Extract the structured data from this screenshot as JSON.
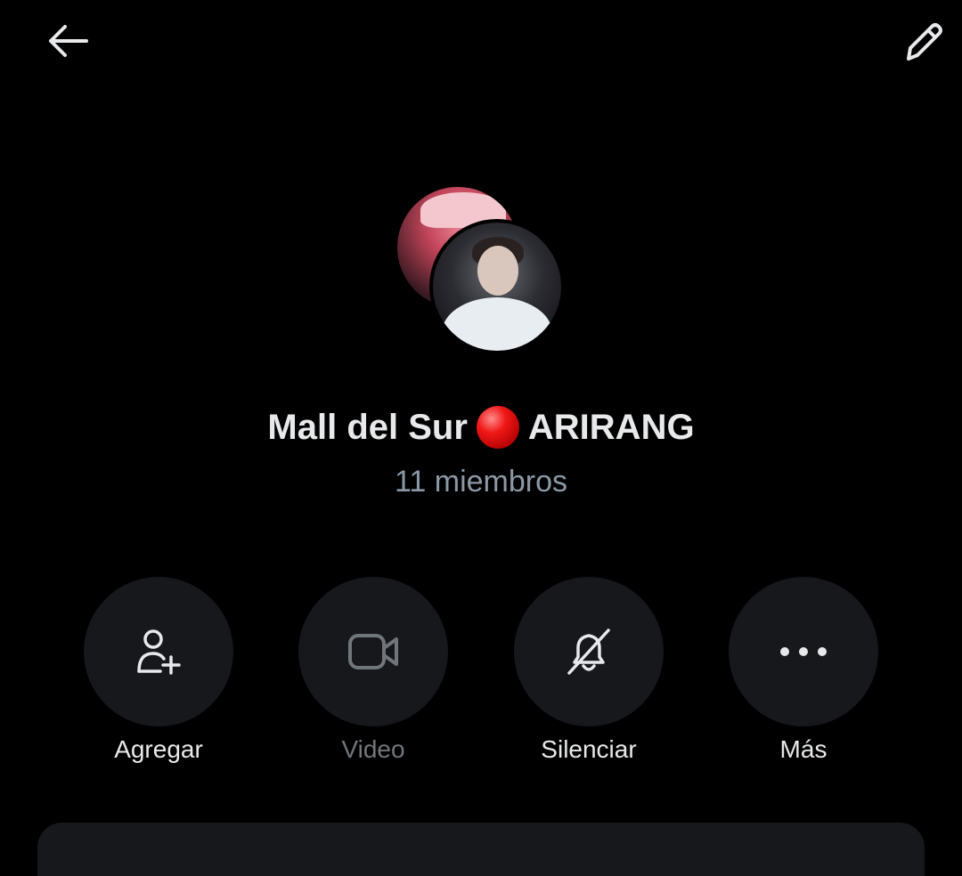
{
  "header": {
    "back_icon": "arrow-left-icon",
    "edit_icon": "pencil-icon"
  },
  "group": {
    "name_part1": "Mall del Sur",
    "name_emoji": "red-circle",
    "name_part2": "ARIRANG",
    "members": "11 miembros"
  },
  "actions": [
    {
      "label": "Agregar",
      "icon": "add-person-icon",
      "enabled": true
    },
    {
      "label": "Video",
      "icon": "video-camera-icon",
      "enabled": false
    },
    {
      "label": "Silenciar",
      "icon": "bell-off-icon",
      "enabled": true
    },
    {
      "label": "Más",
      "icon": "more-horizontal-icon",
      "enabled": true
    }
  ],
  "colors": {
    "background": "#000000",
    "text_primary": "#e7e9ea",
    "text_secondary": "#8b98a5",
    "button_bg": "#16181c",
    "disabled": "#71767b"
  }
}
